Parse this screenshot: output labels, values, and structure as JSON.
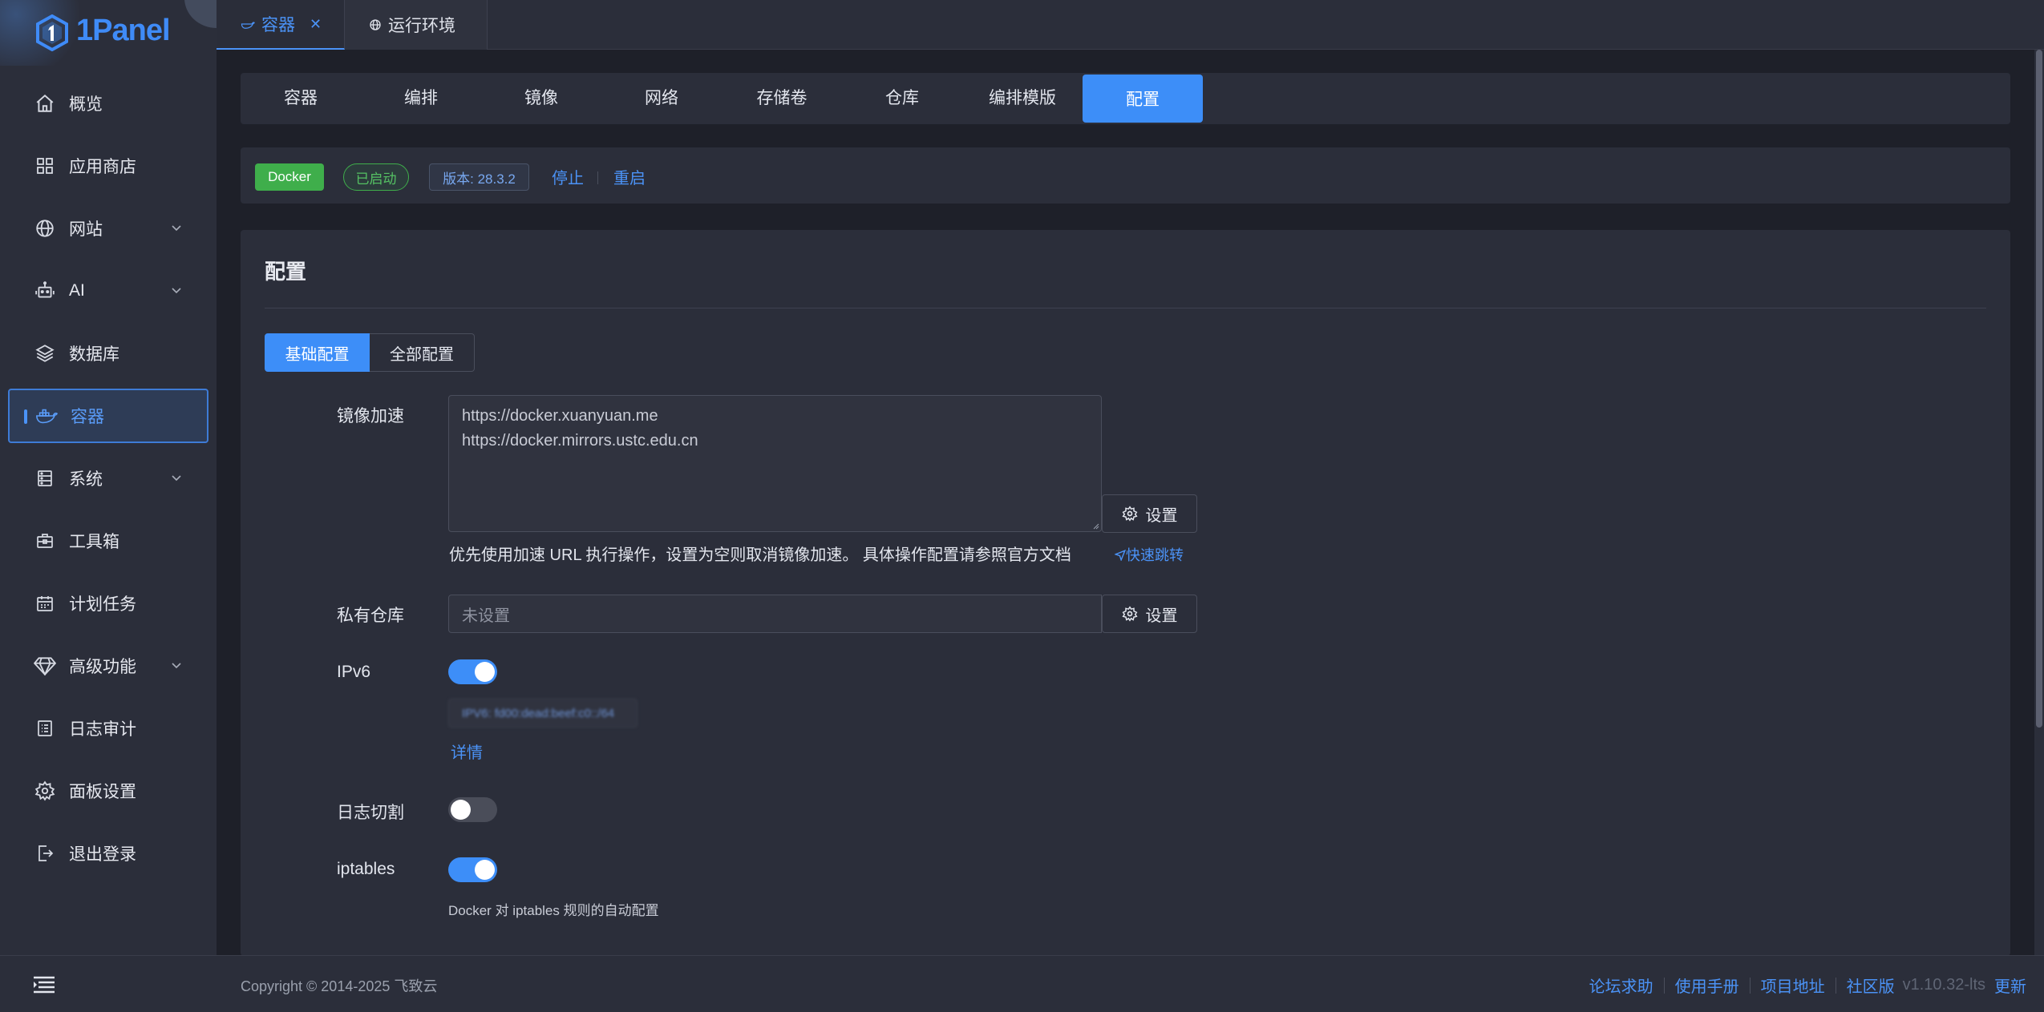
{
  "brand": {
    "name": "1Panel",
    "color": "#3f8bf7"
  },
  "sidebar": {
    "items": [
      {
        "label": "概览",
        "icon": "home-icon"
      },
      {
        "label": "应用商店",
        "icon": "apps-grid-icon"
      },
      {
        "label": "网站",
        "icon": "globe-icon",
        "expandable": true
      },
      {
        "label": "AI",
        "icon": "robot-icon",
        "expandable": true
      },
      {
        "label": "数据库",
        "icon": "layers-icon"
      },
      {
        "label": "容器",
        "icon": "docker-whale-icon",
        "active": true
      },
      {
        "label": "系统",
        "icon": "server-icon",
        "expandable": true
      },
      {
        "label": "工具箱",
        "icon": "toolbox-icon"
      },
      {
        "label": "计划任务",
        "icon": "calendar-icon"
      },
      {
        "label": "高级功能",
        "icon": "diamond-icon",
        "expandable": true
      },
      {
        "label": "日志审计",
        "icon": "log-list-icon"
      },
      {
        "label": "面板设置",
        "icon": "gear-icon"
      },
      {
        "label": "退出登录",
        "icon": "logout-icon"
      }
    ]
  },
  "top_tabs": [
    {
      "label": "容器",
      "active": true,
      "closable": true
    },
    {
      "label": "运行环境",
      "active": false
    }
  ],
  "sub_nav": [
    {
      "label": "容器"
    },
    {
      "label": "编排"
    },
    {
      "label": "镜像"
    },
    {
      "label": "网络"
    },
    {
      "label": "存储卷"
    },
    {
      "label": "仓库"
    },
    {
      "label": "编排模版"
    },
    {
      "label": "配置",
      "active": true
    }
  ],
  "status": {
    "docker_badge": "Docker",
    "state": "已启动",
    "version": "版本: 28.3.2",
    "stop": "停止",
    "restart": "重启"
  },
  "config": {
    "title": "配置",
    "mode_tabs": {
      "basic": "基础配置",
      "all": "全部配置"
    },
    "mirror": {
      "label": "镜像加速",
      "value": "https://docker.xuanyuan.me\nhttps://docker.mirrors.ustc.edu.cn",
      "lines": [
        "https://docker.xuanyuan.me",
        "https://docker.mirrors.ustc.edu.cn"
      ],
      "button": "设置",
      "help": "优先使用加速 URL 执行操作，设置为空则取消镜像加速。 具体操作配置请参照官方文档",
      "jump": "快速跳转"
    },
    "registry": {
      "label": "私有仓库",
      "placeholder": "未设置",
      "button": "设置"
    },
    "ipv6": {
      "label": "IPv6",
      "enabled": true,
      "blurred_value": "IPV6: fd00:dead:beef:c0::/64",
      "detail": "详情"
    },
    "log_rotate": {
      "label": "日志切割",
      "enabled": false
    },
    "iptables": {
      "label": "iptables",
      "enabled": true,
      "note": "Docker 对 iptables 规则的自动配置"
    }
  },
  "footer": {
    "copyright": "Copyright © 2014-2025 飞致云",
    "links": [
      "论坛求助",
      "使用手册",
      "项目地址",
      "社区版"
    ],
    "version": "v1.10.32-lts",
    "update": "更新"
  },
  "colors": {
    "accent": "#3d8ef8",
    "success": "#3fae4b",
    "background": "#1e2029",
    "panel": "#2b2e3a"
  }
}
